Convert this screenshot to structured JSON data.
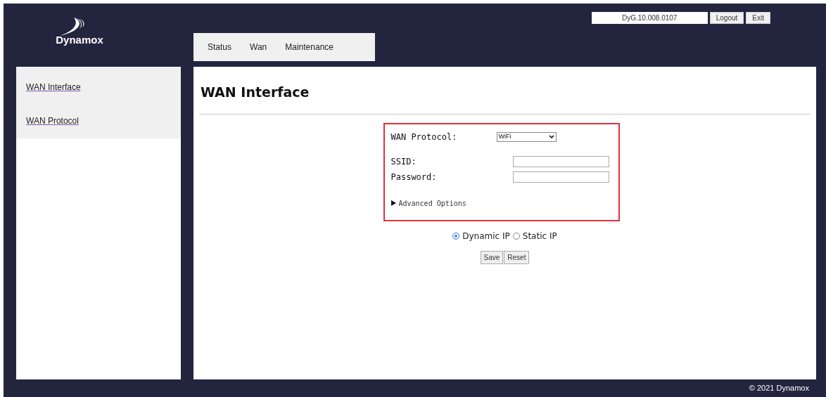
{
  "header": {
    "logo_text": "Dynamox",
    "version": "DyG.10.008.0107",
    "buttons": [
      "Logout",
      "Exit"
    ]
  },
  "tabs": [
    {
      "label": "Status",
      "selected": false
    },
    {
      "label": "Wan",
      "selected": false
    },
    {
      "label": "Maintenance",
      "selected": false
    }
  ],
  "sidebar": {
    "items": [
      {
        "label": "WAN Interface"
      },
      {
        "label": "WAN Protocol"
      }
    ]
  },
  "main": {
    "title": "WAN Interface",
    "form": {
      "protocol_label": "WAN Protocol:",
      "protocol_value": "WiFi",
      "fields": [
        {
          "label": "SSID:"
        },
        {
          "label": "Password:"
        }
      ],
      "advanced": {
        "label": "Advanced Options",
        "expanded": false
      }
    },
    "ip_modes": [
      {
        "label": "Dynamic IP",
        "selected": true
      },
      {
        "label": "Static IP",
        "selected": false
      }
    ],
    "buttons": [
      "Save",
      "Reset"
    ]
  },
  "footer": "© 2021 Dynamox"
}
